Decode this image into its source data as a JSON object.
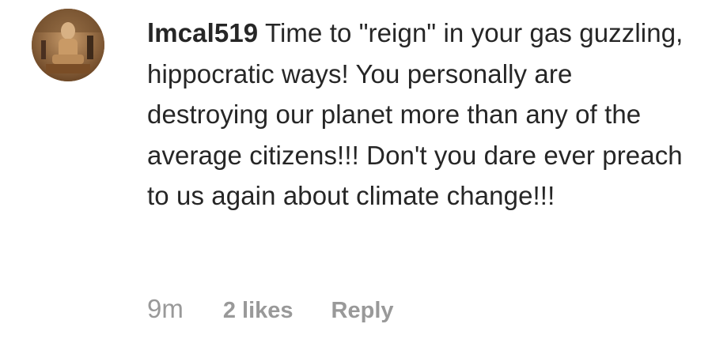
{
  "comment": {
    "username": "lmcal519",
    "text": "Time to \"reign\" in your gas guzzling, hippocratic ways! You personally are destroying our planet more than any of the average citizens!!! Don't you dare ever preach to us again about climate change!!!",
    "timestamp": "9m",
    "likes": "2 likes",
    "reply_label": "Reply",
    "avatar_icon": "user-avatar-photo"
  },
  "colors": {
    "text": "#262626",
    "meta": "#999999",
    "background": "#ffffff"
  }
}
